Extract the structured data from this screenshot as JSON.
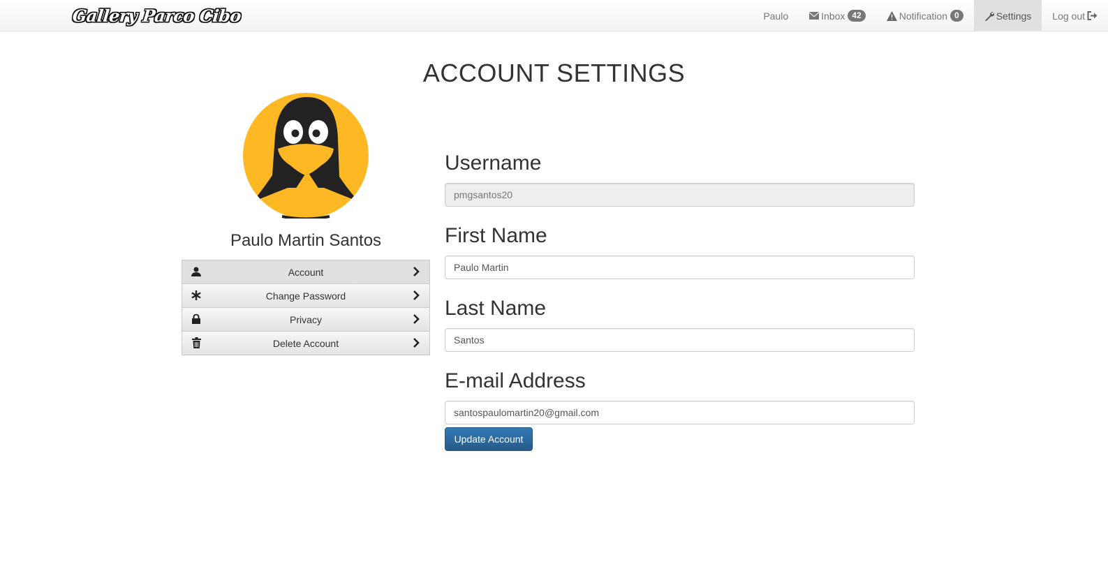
{
  "navbar": {
    "brand": "Gallery Parco Cibo",
    "user": "Paulo",
    "inbox_label": "Inbox",
    "inbox_count": "42",
    "notification_label": "Notification",
    "notification_count": "0",
    "settings_label": "Settings",
    "logout_label": "Log out"
  },
  "page": {
    "title": "ACCOUNT SETTINGS"
  },
  "profile": {
    "name": "Paulo Martin Santos",
    "avatar_colors": {
      "background": "#FDB823",
      "body": "#222222",
      "beak": "#FDB823"
    }
  },
  "menu": {
    "items": [
      {
        "label": "Account",
        "icon": "user-icon"
      },
      {
        "label": "Change Password",
        "icon": "asterisk-icon"
      },
      {
        "label": "Privacy",
        "icon": "lock-icon"
      },
      {
        "label": "Delete Account",
        "icon": "trash-icon"
      }
    ]
  },
  "form": {
    "username_label": "Username",
    "username_value": "pmgsantos20",
    "first_name_label": "First Name",
    "first_name_value": "Paulo Martin",
    "last_name_label": "Last Name",
    "last_name_value": "Santos",
    "email_label": "E-mail Address",
    "email_value": "santospaulomartin20@gmail.com",
    "submit_label": "Update Account"
  },
  "colors": {
    "primary_button": "#337ab7",
    "badge": "#777777",
    "nav_active": "#e0e0e0"
  }
}
